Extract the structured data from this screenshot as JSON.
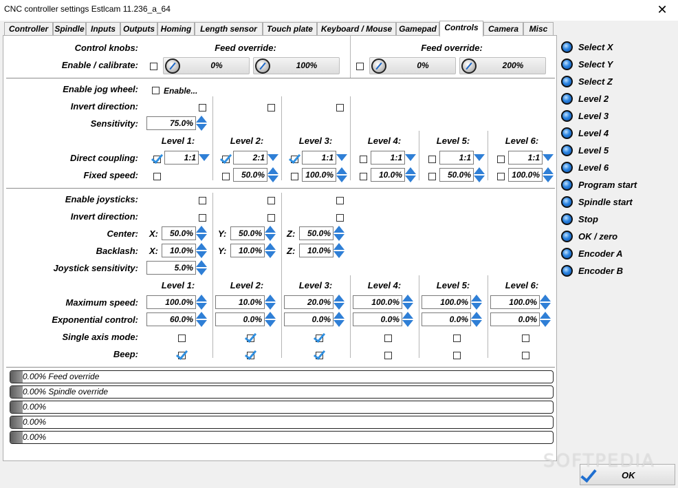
{
  "window": {
    "title": "CNC controller settings Estlcam 11.236_a_64",
    "close_glyph": "✕"
  },
  "tabs": [
    {
      "label": "Controller",
      "active": false
    },
    {
      "label": "Spindle",
      "active": false
    },
    {
      "label": "Inputs",
      "active": false
    },
    {
      "label": "Outputs",
      "active": false
    },
    {
      "label": "Homing",
      "active": false
    },
    {
      "label": "Length sensor",
      "active": false
    },
    {
      "label": "Touch plate",
      "active": false
    },
    {
      "label": "Keyboard / Mouse",
      "active": false
    },
    {
      "label": "Gamepad",
      "active": false
    },
    {
      "label": "Controls",
      "active": true
    },
    {
      "label": "Camera",
      "active": false
    },
    {
      "label": "Misc",
      "active": false
    }
  ],
  "control_knobs": {
    "label": "Control knobs:",
    "enable_label": "Enable / calibrate:",
    "left": {
      "title": "Feed override:",
      "enabled": false,
      "min": "0%",
      "max": "100%"
    },
    "right": {
      "title": "Feed override:",
      "enabled": false,
      "min": "0%",
      "max": "200%"
    }
  },
  "jog_wheel": {
    "enable_label": "Enable jog wheel:",
    "enable_checkbox_label": "Enable...",
    "enabled": false,
    "invert_label": "Invert direction:",
    "invert": [
      false,
      false,
      false
    ],
    "sensitivity_label": "Sensitivity:",
    "sensitivity": "75.0%",
    "direct_coupling_label": "Direct coupling:",
    "fixed_speed_label": "Fixed speed:",
    "levels": [
      {
        "label": "Level 1:",
        "coupling_checked": true,
        "coupling": "1:1",
        "fixed_checked": false,
        "fixed": ""
      },
      {
        "label": "Level 2:",
        "coupling_checked": true,
        "coupling": "2:1",
        "fixed_checked": false,
        "fixed": "50.0%"
      },
      {
        "label": "Level 3:",
        "coupling_checked": true,
        "coupling": "1:1",
        "fixed_checked": false,
        "fixed": "100.0%"
      },
      {
        "label": "Level 4:",
        "coupling_checked": false,
        "coupling": "1:1",
        "fixed_checked": false,
        "fixed": "10.0%"
      },
      {
        "label": "Level 5:",
        "coupling_checked": false,
        "coupling": "1:1",
        "fixed_checked": false,
        "fixed": "50.0%"
      },
      {
        "label": "Level 6:",
        "coupling_checked": false,
        "coupling": "1:1",
        "fixed_checked": false,
        "fixed": "100.0%"
      }
    ]
  },
  "joysticks": {
    "enable_label": "Enable joysticks:",
    "enable": [
      false,
      false,
      false
    ],
    "invert_label": "Invert direction:",
    "invert": [
      false,
      false,
      false
    ],
    "center_label": "Center:",
    "backlash_label": "Backlash:",
    "axes": [
      {
        "axis": "X:",
        "center": "50.0%",
        "backlash": "10.0%"
      },
      {
        "axis": "Y:",
        "center": "50.0%",
        "backlash": "10.0%"
      },
      {
        "axis": "Z:",
        "center": "50.0%",
        "backlash": "10.0%"
      }
    ],
    "sensitivity_label": "Joystick sensitivity:",
    "sensitivity": "5.0%",
    "max_speed_label": "Maximum speed:",
    "exp_control_label": "Exponential control:",
    "single_axis_label": "Single axis mode:",
    "beep_label": "Beep:",
    "levels": [
      {
        "label": "Level 1:",
        "max_speed": "100.0%",
        "exp": "60.0%",
        "single_axis": false,
        "beep": true
      },
      {
        "label": "Level 2:",
        "max_speed": "10.0%",
        "exp": "0.0%",
        "single_axis": true,
        "beep": true
      },
      {
        "label": "Level 3:",
        "max_speed": "20.0%",
        "exp": "0.0%",
        "single_axis": true,
        "beep": true
      },
      {
        "label": "Level 4:",
        "max_speed": "100.0%",
        "exp": "0.0%",
        "single_axis": false,
        "beep": false
      },
      {
        "label": "Level 5:",
        "max_speed": "100.0%",
        "exp": "0.0%",
        "single_axis": false,
        "beep": false
      },
      {
        "label": "Level 6:",
        "max_speed": "100.0%",
        "exp": "0.0%",
        "single_axis": false,
        "beep": false
      }
    ]
  },
  "progress_bars": [
    {
      "text": "0.00% Feed override",
      "value": 0
    },
    {
      "text": "0.00% Spindle override",
      "value": 0
    },
    {
      "text": "0.00%",
      "value": 0
    },
    {
      "text": "0.00%",
      "value": 0
    },
    {
      "text": "0.00%",
      "value": 0
    }
  ],
  "inputs_list": [
    "Select X",
    "Select Y",
    "Select Z",
    "Level 2",
    "Level 3",
    "Level 4",
    "Level 5",
    "Level 6",
    "Program start",
    "Spindle start",
    "Stop",
    "OK / zero",
    "Encoder A",
    "Encoder B"
  ],
  "ok_button": {
    "label": "OK"
  },
  "watermark": "SOFTPEDIA",
  "colors": {
    "accent": "#2f7fd6",
    "led": "#2a83e0"
  }
}
